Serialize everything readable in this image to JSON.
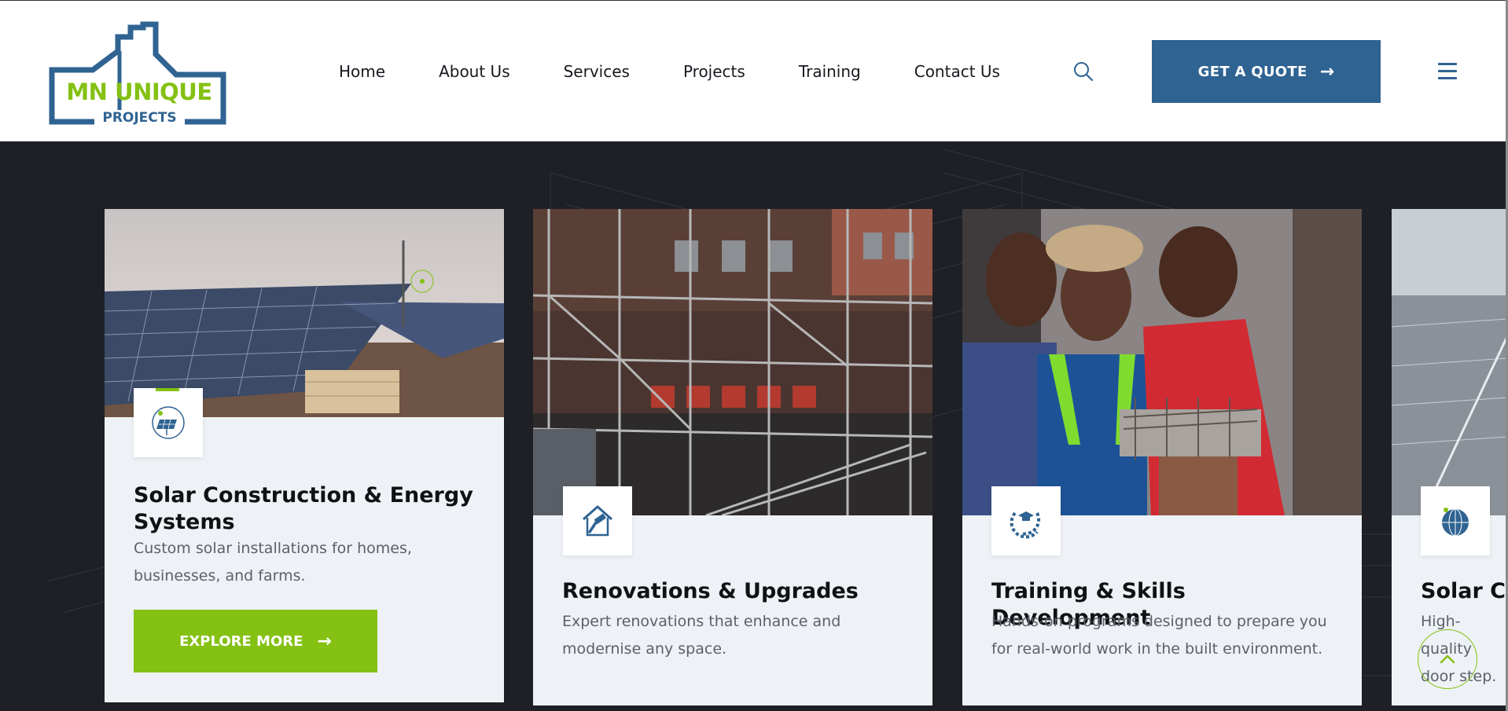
{
  "logo": {
    "line1": "MN UNIQUE",
    "line2": "PROJECTS"
  },
  "nav": {
    "items": [
      {
        "label": "Home"
      },
      {
        "label": "About Us"
      },
      {
        "label": "Services"
      },
      {
        "label": "Projects"
      },
      {
        "label": "Training"
      },
      {
        "label": "Contact Us"
      }
    ],
    "quote_label": "GET A QUOTE",
    "icons": {
      "search": "search-icon",
      "menu": "hamburger-menu-icon",
      "arrow": "arrow-right-icon"
    }
  },
  "services": [
    {
      "title": "Solar Construction & Energy Systems",
      "description": "Custom solar installations for homes, businesses, and farms.",
      "button": "EXPLORE MORE",
      "icon": "solar-panel-icon"
    },
    {
      "title": "Renovations & Upgrades",
      "description": "Expert renovations that enhance and modernise any space.",
      "icon": "house-hammer-icon"
    },
    {
      "title": "Training & Skills Development",
      "description": "Hands-on programs designed to prepare you for real-world work in the built environment.",
      "icon": "graduation-laurel-icon"
    },
    {
      "title": "Solar Cle",
      "description": "High-quality door step.",
      "icon": "globe-grid-icon"
    }
  ],
  "colors": {
    "brand_blue": "#2f6392",
    "brand_green": "#84c113",
    "dark_bg": "#1e2025",
    "card_bg": "#eef2f6"
  }
}
